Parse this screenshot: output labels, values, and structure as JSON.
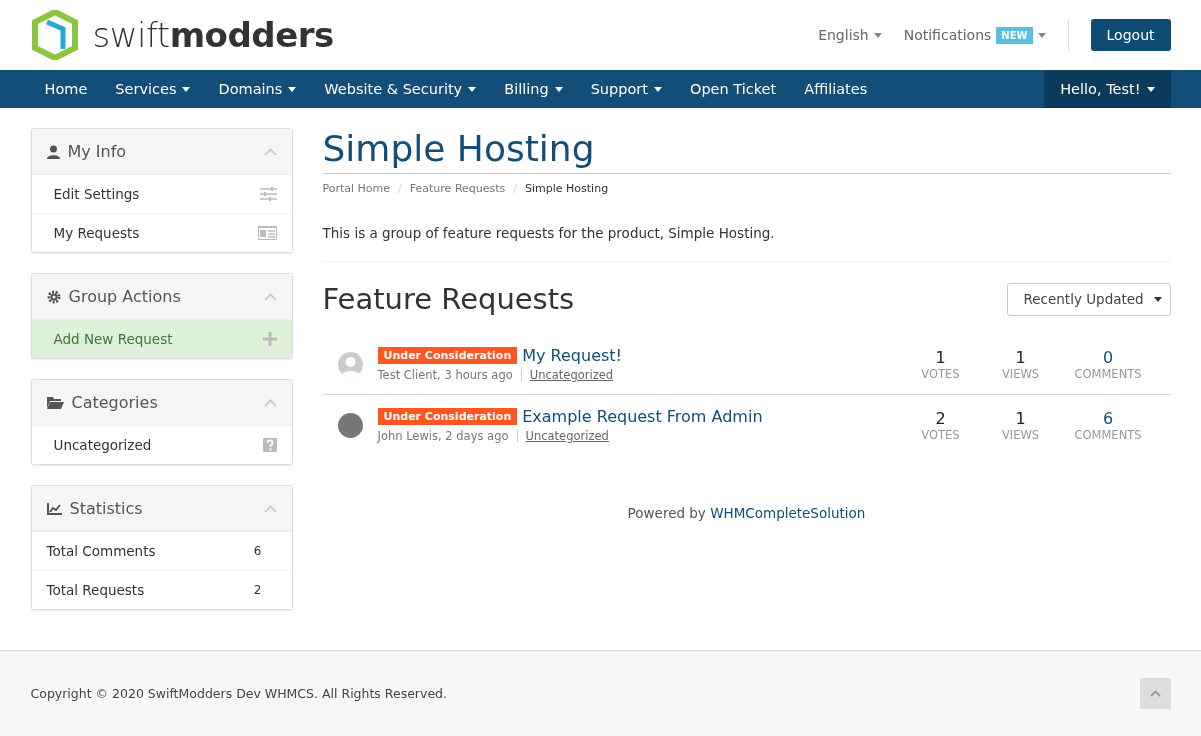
{
  "header": {
    "logo": "swift**modders**",
    "language": "English",
    "notifications": {
      "label": "Notifications",
      "badge": "NEW"
    },
    "logout": "Logout"
  },
  "nav": {
    "items": [
      {
        "label": "Home",
        "dropdown": false
      },
      {
        "label": "Services",
        "dropdown": true
      },
      {
        "label": "Domains",
        "dropdown": true
      },
      {
        "label": "Website & Security",
        "dropdown": true
      },
      {
        "label": "Billing",
        "dropdown": true
      },
      {
        "label": "Support",
        "dropdown": true
      },
      {
        "label": "Open Ticket",
        "dropdown": false
      },
      {
        "label": "Affiliates",
        "dropdown": false
      }
    ],
    "account": "Hello, Test!"
  },
  "sidebar": [
    {
      "title": "My Info",
      "items": [
        {
          "label": "Edit Settings",
          "kind": "link"
        },
        {
          "label": "My Requests",
          "kind": "link"
        }
      ]
    },
    {
      "title": "Group Actions",
      "items": [
        {
          "label": "Add New Request",
          "kind": "action"
        }
      ]
    },
    {
      "title": "Categories",
      "items": [
        {
          "label": "Uncategorized",
          "kind": "link"
        }
      ]
    },
    {
      "title": "Statistics",
      "items": [
        {
          "label": "Total Comments",
          "kind": "stat",
          "count": "6"
        },
        {
          "label": "Total Requests",
          "kind": "stat",
          "count": "2"
        }
      ]
    }
  ],
  "main": {
    "title": "Simple Hosting",
    "breadcrumb": [
      "Portal Home",
      "Feature Requests",
      "Simple Hosting"
    ],
    "breadcrumb_separator": "/",
    "description": "This is a group of feature requests for the product, Simple Hosting.",
    "section_title": "Feature Requests",
    "sort": "Recently Updated",
    "requests": [
      {
        "status": "Under Consideration",
        "title": "My Request!",
        "meta": "Test Client, 3 hours ago",
        "category": "Uncategorized",
        "stats": [
          {
            "value": "1",
            "label": "VOTES"
          },
          {
            "value": "1",
            "label": "VIEWS"
          },
          {
            "value": "0",
            "label": "COMMENTS"
          }
        ]
      },
      {
        "status": "Under Consideration",
        "title": "Example Request From Admin",
        "meta": "John Lewis, 2 days ago",
        "category": "Uncategorized",
        "stats": [
          {
            "value": "2",
            "label": "VOTES"
          },
          {
            "value": "1",
            "label": "VIEWS"
          },
          {
            "value": "6",
            "label": "COMMENTS"
          }
        ]
      }
    ],
    "powered": {
      "prefix": "Powered by",
      "link": "WHMCompleteSolution"
    }
  },
  "footer": {
    "copyright": "Copyright © 2020 SwiftModders Dev WHMCS. All Rights Reserved."
  }
}
